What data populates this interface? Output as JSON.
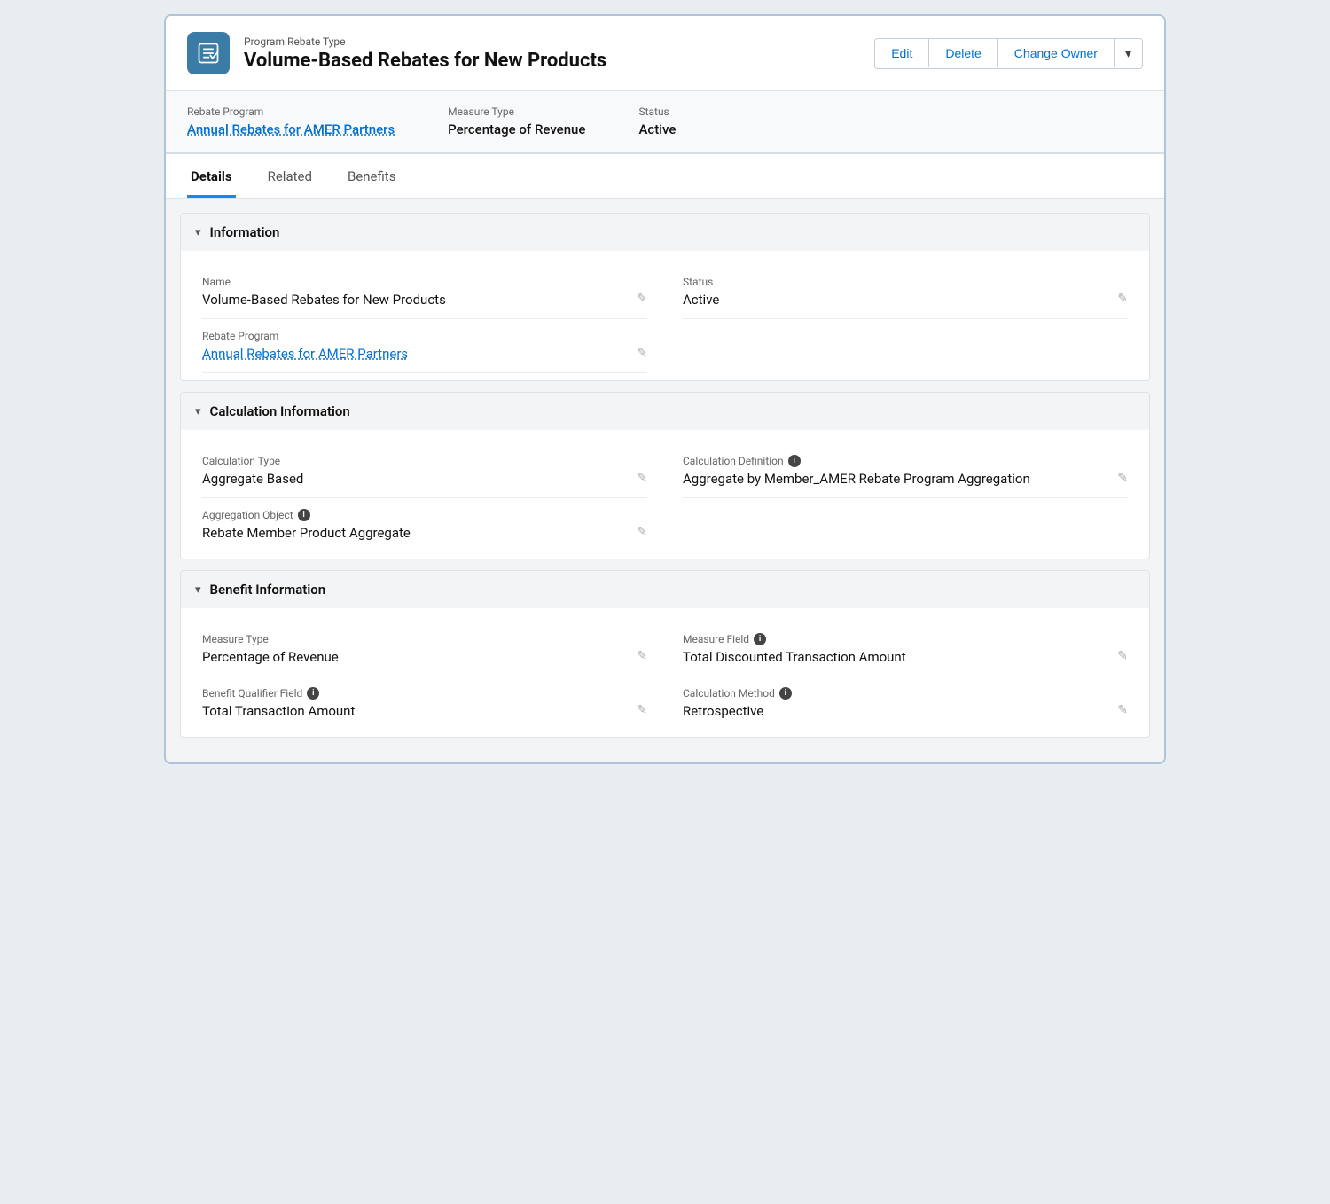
{
  "header": {
    "object_type": "Program Rebate Type",
    "title": "Volume-Based Rebates for New Products",
    "actions": {
      "edit_label": "Edit",
      "delete_label": "Delete",
      "change_owner_label": "Change Owner"
    }
  },
  "summary": {
    "fields": [
      {
        "label": "Rebate Program",
        "value": "Annual Rebates for AMER Partners",
        "is_link": true
      },
      {
        "label": "Measure Type",
        "value": "Percentage of Revenue",
        "is_link": false
      },
      {
        "label": "Status",
        "value": "Active",
        "is_link": false
      }
    ]
  },
  "tabs": [
    {
      "label": "Details",
      "active": true
    },
    {
      "label": "Related",
      "active": false
    },
    {
      "label": "Benefits",
      "active": false
    }
  ],
  "sections": [
    {
      "id": "information",
      "title": "Information",
      "fields": [
        {
          "label": "Name",
          "value": "Volume-Based Rebates for New Products",
          "is_link": false,
          "has_info": false,
          "column": 1
        },
        {
          "label": "Status",
          "value": "Active",
          "is_link": false,
          "has_info": false,
          "column": 2
        },
        {
          "label": "Rebate Program",
          "value": "Annual Rebates for AMER Partners",
          "is_link": true,
          "has_info": false,
          "column": 1
        }
      ]
    },
    {
      "id": "calculation-information",
      "title": "Calculation Information",
      "fields": [
        {
          "label": "Calculation Type",
          "value": "Aggregate Based",
          "is_link": false,
          "has_info": false,
          "column": 1
        },
        {
          "label": "Calculation Definition",
          "value": "Aggregate by Member_AMER Rebate Program Aggregation",
          "is_link": false,
          "has_info": true,
          "column": 2
        },
        {
          "label": "Aggregation Object",
          "value": "Rebate Member Product Aggregate",
          "is_link": false,
          "has_info": true,
          "column": 1
        }
      ]
    },
    {
      "id": "benefit-information",
      "title": "Benefit Information",
      "fields": [
        {
          "label": "Measure Type",
          "value": "Percentage of Revenue",
          "is_link": false,
          "has_info": false,
          "column": 1
        },
        {
          "label": "Measure Field",
          "value": "Total Discounted Transaction Amount",
          "is_link": false,
          "has_info": true,
          "column": 2
        },
        {
          "label": "Benefit Qualifier Field",
          "value": "Total Transaction Amount",
          "is_link": false,
          "has_info": true,
          "column": 1
        },
        {
          "label": "Calculation Method",
          "value": "Retrospective",
          "is_link": false,
          "has_info": true,
          "column": 2
        }
      ]
    }
  ],
  "icons": {
    "chevron_down": "▾",
    "edit_pencil": "✎",
    "info": "i",
    "dropdown_arrow": "▾"
  }
}
